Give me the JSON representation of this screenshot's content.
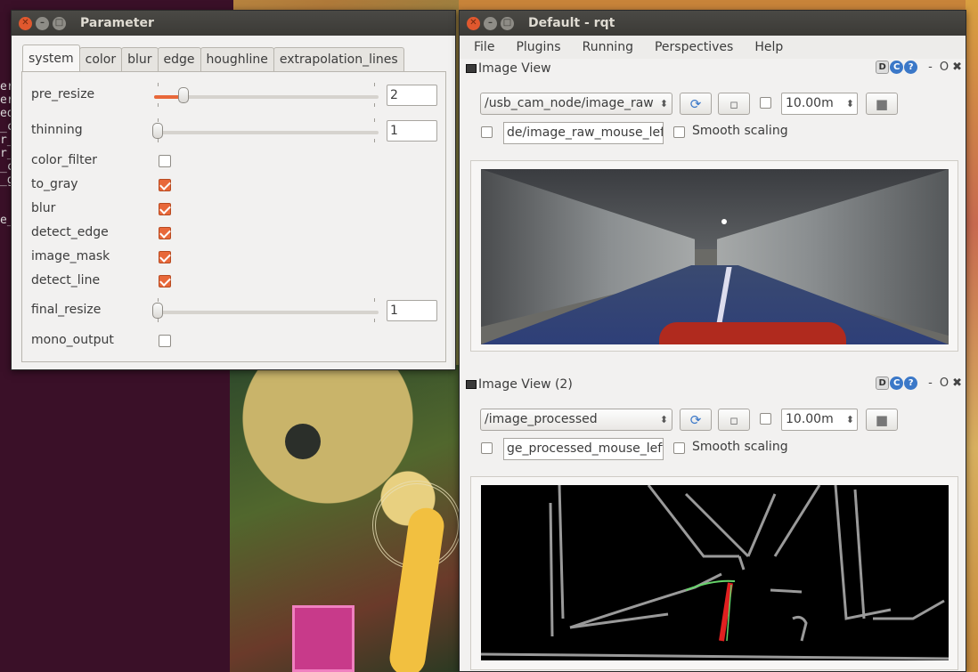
{
  "parameter_window": {
    "title": "Parameter",
    "tabs": [
      "system",
      "color",
      "blur",
      "edge",
      "houghline",
      "extrapolation_lines"
    ],
    "active_tab": "system",
    "params": {
      "pre_resize": {
        "label": "pre_resize",
        "value": "2",
        "level": 0.12
      },
      "thinning": {
        "label": "thinning",
        "value": "1",
        "level": 0.0
      },
      "color_filter": {
        "label": "color_filter",
        "checked": false
      },
      "to_gray": {
        "label": "to_gray",
        "checked": true
      },
      "blur": {
        "label": "blur",
        "checked": true
      },
      "detect_edge": {
        "label": "detect_edge",
        "checked": true
      },
      "image_mask": {
        "label": "image_mask",
        "checked": true
      },
      "detect_line": {
        "label": "detect_line",
        "checked": true
      },
      "final_resize": {
        "label": "final_resize",
        "value": "1",
        "level": 0.0
      },
      "mono_output": {
        "label": "mono_output",
        "checked": false
      }
    }
  },
  "rqt_window": {
    "title": "Default - rqt",
    "menu": [
      "File",
      "Plugins",
      "Running",
      "Perspectives",
      "Help"
    ],
    "plugin_controls": {
      "d": "D",
      "refresh": "C",
      "help": "?",
      "minimize": "-",
      "float": "O",
      "close": "✖"
    },
    "image_view_1": {
      "title": "Image View",
      "topic": "/usb_cam_node/image_raw",
      "rate": "10.00m",
      "mouse_topic": "de/image_raw_mouse_left",
      "smooth_label": "Smooth scaling"
    },
    "image_view_2": {
      "title": "Image View (2)",
      "topic": "/image_processed",
      "rate": "10.00m",
      "mouse_topic": "ge_processed_mouse_left",
      "smooth_label": "Smooth scaling"
    }
  },
  "terminal_fragment": "er\ner\ned\n_c\nr_\nr_\n_c\n_g\n\n\ne_",
  "colors": {
    "accent": "#e8683a",
    "titlebar": "#3b3a36",
    "window_bg": "#f2f1f0",
    "refresh_blue": "#3b78c8"
  },
  "icons": [
    "close-icon",
    "minimize-icon",
    "maximize-icon",
    "refresh-icon",
    "pause-icon",
    "save-icon",
    "help-icon"
  ]
}
